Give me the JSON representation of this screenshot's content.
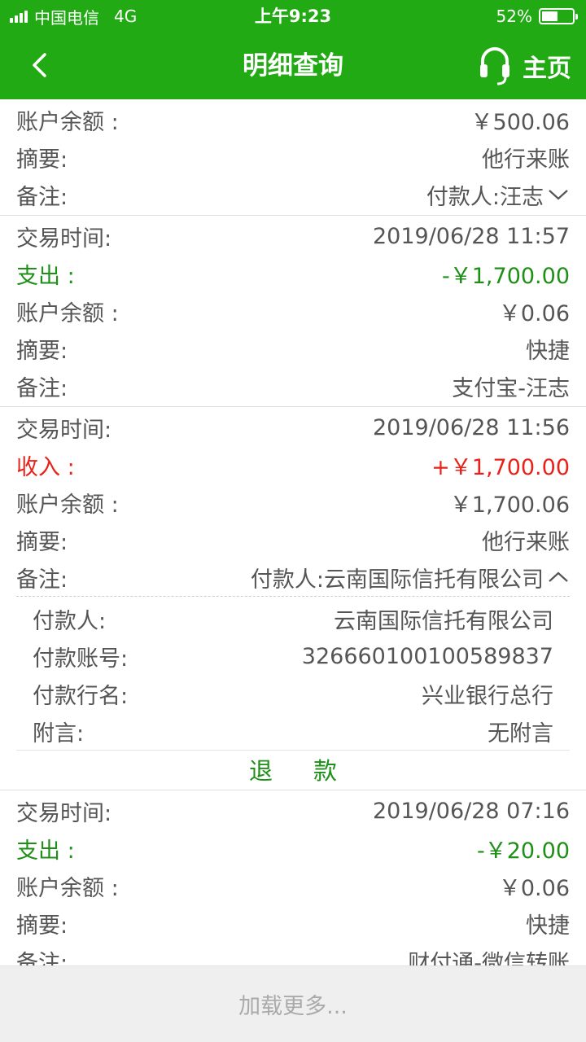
{
  "status_bar": {
    "carrier": "中国电信",
    "network": "4G",
    "time": "上午9:23",
    "battery": "52%",
    "battery_level": 0.52
  },
  "nav": {
    "title": "明细查询",
    "home_label": "主页",
    "icons": {
      "back": "chevron-left-icon",
      "support": "headset-icon"
    }
  },
  "records": [
    {
      "balance_label": "账户余额 :",
      "balance": "￥500.06",
      "summary_label": "摘要:",
      "summary": "他行来账",
      "note_label": "备注:",
      "note": "付款人:汪志"
    },
    {
      "time_label": "交易时间:",
      "time": "2019/06/28 11:57",
      "amount_label": "支出 :",
      "amount": "-￥1,700.00",
      "balance_label": "账户余额 :",
      "balance": "￥0.06",
      "summary_label": "摘要:",
      "summary": "快捷",
      "note_label": "备注:",
      "note": "支付宝-汪志"
    },
    {
      "time_label": "交易时间:",
      "time": "2019/06/28 11:56",
      "amount_label": "收入 :",
      "amount": "+￥1,700.00",
      "balance_label": "账户余额 :",
      "balance": "￥1,700.06",
      "summary_label": "摘要:",
      "summary": "他行来账",
      "note_label": "备注:",
      "note": "付款人:云南国际信托有限公司",
      "detail": {
        "payer_label": "付款人:",
        "payer": "云南国际信托有限公司",
        "account_label": "付款账号:",
        "account": "326660100100589837",
        "bank_label": "付款行名:",
        "bank": "兴业银行总行",
        "memo_label": "附言:",
        "memo": "无附言"
      },
      "refund_label": "退款"
    },
    {
      "time_label": "交易时间:",
      "time": "2019/06/28 07:16",
      "amount_label": "支出 :",
      "amount": "-￥20.00",
      "balance_label": "账户余额 :",
      "balance": "￥0.06",
      "summary_label": "摘要:",
      "summary": "快捷",
      "note_label": "备注:",
      "note": "财付通-微信转账"
    }
  ],
  "load_more": "加载更多...",
  "colors": {
    "brand": "#22aa14",
    "expense": "#1e8f17",
    "income": "#e8221a"
  }
}
